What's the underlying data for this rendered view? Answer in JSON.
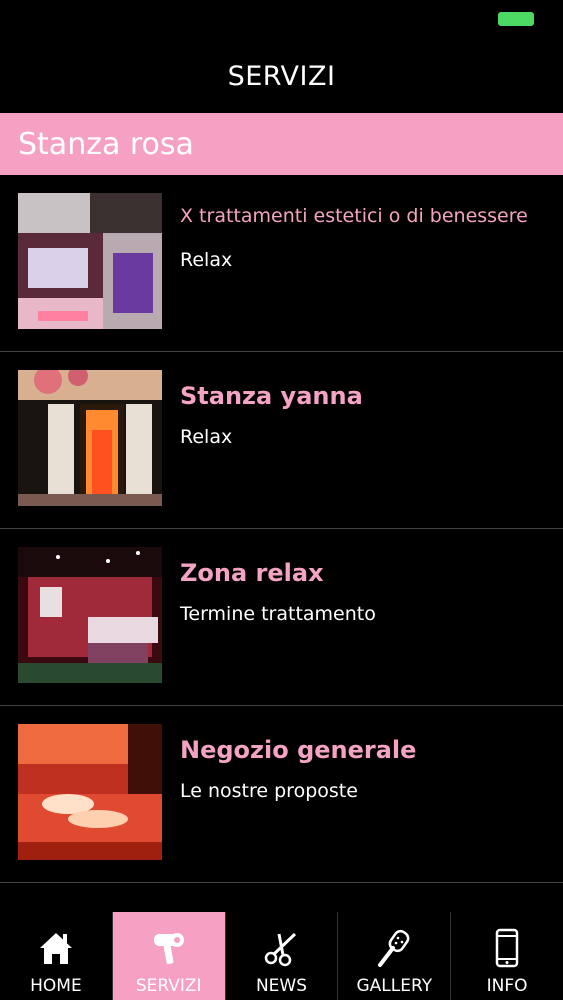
{
  "status_bar": {
    "battery_color": "#4cd964"
  },
  "nav": {
    "title": "SERVIZI"
  },
  "section": {
    "title": "Stanza rosa",
    "color": "#f6a0c3"
  },
  "items": [
    {
      "title": "X trattamenti estetici o di benessere",
      "subtitle": "Relax"
    },
    {
      "title": "Stanza yanna",
      "subtitle": "Relax"
    },
    {
      "title": "Zona relax",
      "subtitle": "Termine trattamento"
    },
    {
      "title": "Negozio generale",
      "subtitle": "Le nostre proposte"
    }
  ],
  "tabs": [
    {
      "label": "HOME",
      "icon": "home-icon"
    },
    {
      "label": "SERVIZI",
      "icon": "hair-dryer-icon",
      "active": true
    },
    {
      "label": "NEWS",
      "icon": "scissors-icon"
    },
    {
      "label": "GALLERY",
      "icon": "brush-icon"
    },
    {
      "label": "INFO",
      "icon": "phone-icon"
    }
  ]
}
